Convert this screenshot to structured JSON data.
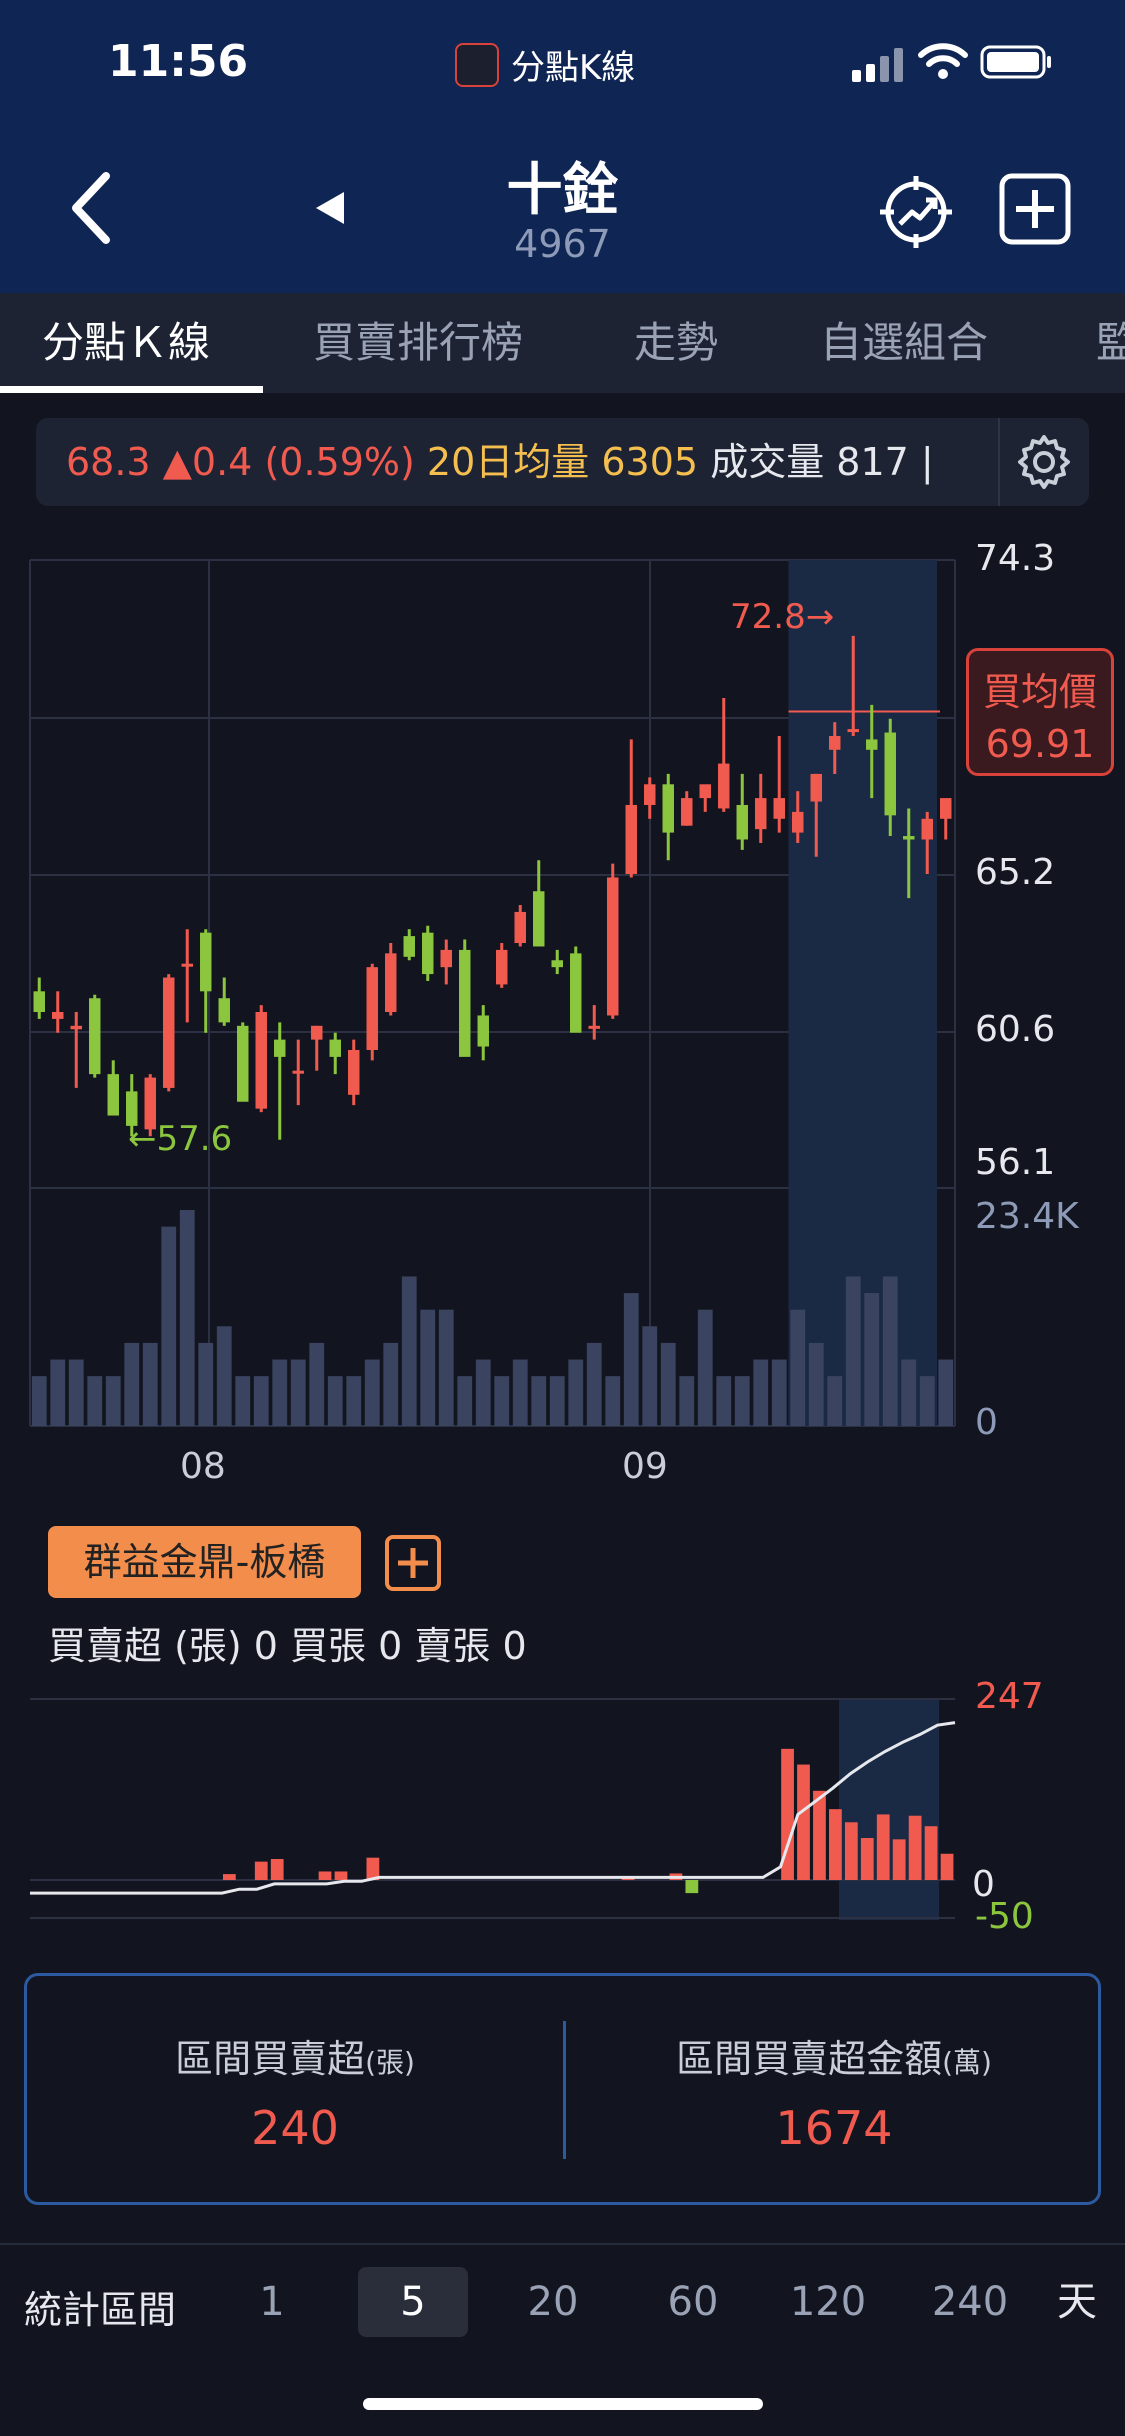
{
  "status_bar": {
    "time": "11:56",
    "app_name": "分點K線"
  },
  "header": {
    "stock_name": "十銓",
    "stock_code": "4967"
  },
  "tabs": [
    "分點Ｋ線",
    "買賣排行榜",
    "走勢",
    "自選組合",
    "監"
  ],
  "quote": {
    "price": "68.3",
    "change": "▲0.4",
    "change_pct": "(0.59%)",
    "avg_vol_label": "20日均量",
    "avg_vol": "6305",
    "volume_label": "成交量",
    "volume": "817",
    "separator": "|"
  },
  "avg_price_tag": {
    "label": "買均價",
    "value": "69.91"
  },
  "broker": {
    "name": "群益金鼎-板橋",
    "net_line": "買賣超 (張) 0 買張 0 賣張 0"
  },
  "summary": {
    "left_label": "區間買賣超",
    "left_unit": "(張)",
    "left_value": "240",
    "right_label": "區間買賣超金額",
    "right_unit": "(萬)",
    "right_value": "1674"
  },
  "period": {
    "label": "統計區間",
    "options": [
      "1",
      "5",
      "20",
      "60",
      "120",
      "240"
    ],
    "selected": "5",
    "unit": "天"
  },
  "colors": {
    "up": "#f15b4f",
    "down": "#8cc63f",
    "volume": "#3a4460",
    "highlight": "#1a2a44"
  },
  "chart_data": [
    {
      "type": "candlestick",
      "price_axis_ticks": [
        "74.3",
        "65.2",
        "60.6",
        "56.1"
      ],
      "volume_axis_ticks": [
        "23.4K",
        "0"
      ],
      "x_tick_labels": [
        "08",
        "09"
      ],
      "annotations": {
        "high": "72.8→",
        "low": "←57.6"
      },
      "ylim": [
        56.1,
        74.3
      ],
      "ohlc": [
        [
          61.8,
          62.2,
          61.0,
          61.2
        ],
        [
          61.0,
          61.8,
          60.6,
          61.2
        ],
        [
          60.7,
          61.2,
          59.0,
          60.8
        ],
        [
          61.6,
          61.7,
          59.3,
          59.4
        ],
        [
          59.4,
          59.8,
          58.6,
          58.2
        ],
        [
          58.9,
          59.4,
          57.6,
          57.9
        ],
        [
          57.8,
          59.4,
          57.6,
          59.3
        ],
        [
          59.0,
          62.3,
          58.9,
          62.2
        ],
        [
          62.6,
          63.6,
          60.9,
          62.6
        ],
        [
          63.5,
          63.6,
          60.6,
          61.8
        ],
        [
          61.6,
          62.2,
          60.8,
          60.9
        ],
        [
          60.8,
          60.9,
          59.6,
          58.6
        ],
        [
          58.4,
          61.4,
          58.3,
          61.2
        ],
        [
          60.4,
          60.9,
          57.5,
          59.9
        ],
        [
          59.5,
          60.4,
          58.5,
          59.5
        ],
        [
          60.4,
          60.8,
          59.5,
          60.8
        ],
        [
          60.4,
          60.6,
          59.4,
          59.9
        ],
        [
          58.8,
          60.4,
          58.5,
          60.1
        ],
        [
          60.1,
          62.6,
          59.8,
          62.5
        ],
        [
          61.2,
          63.2,
          61.1,
          62.9
        ],
        [
          63.4,
          63.6,
          62.7,
          62.8
        ],
        [
          63.5,
          63.7,
          62.1,
          62.3
        ],
        [
          62.5,
          63.3,
          62.0,
          63.0
        ],
        [
          63.0,
          63.3,
          61.2,
          59.9
        ],
        [
          61.1,
          61.4,
          59.8,
          60.2
        ],
        [
          62.0,
          63.2,
          61.9,
          63.0
        ],
        [
          63.2,
          64.3,
          63.1,
          64.1
        ],
        [
          64.7,
          65.6,
          63.1,
          63.1
        ],
        [
          62.7,
          63.0,
          62.3,
          62.5
        ],
        [
          62.9,
          63.1,
          60.9,
          60.6
        ],
        [
          60.8,
          61.4,
          60.4,
          60.8
        ],
        [
          61.1,
          65.5,
          61.0,
          65.1
        ],
        [
          65.2,
          69.1,
          65.1,
          67.2
        ],
        [
          67.2,
          68.0,
          66.8,
          67.8
        ],
        [
          67.8,
          68.1,
          65.6,
          66.4
        ],
        [
          66.6,
          67.6,
          66.6,
          67.4
        ],
        [
          67.4,
          67.6,
          67.0,
          67.8
        ],
        [
          67.1,
          70.3,
          67.0,
          68.4
        ],
        [
          67.2,
          68.1,
          65.9,
          66.2
        ],
        [
          66.5,
          68.1,
          66.1,
          67.4
        ],
        [
          66.8,
          69.2,
          66.4,
          67.4
        ],
        [
          66.4,
          67.6,
          66.1,
          67.0
        ],
        [
          67.3,
          68.1,
          65.7,
          68.1
        ],
        [
          68.8,
          69.6,
          68.1,
          69.2
        ],
        [
          69.4,
          72.1,
          69.2,
          69.4
        ],
        [
          69.1,
          70.1,
          67.4,
          68.8
        ],
        [
          69.3,
          69.7,
          66.3,
          66.9
        ],
        [
          66.3,
          67.1,
          64.5,
          66.2
        ],
        [
          66.2,
          67.0,
          65.2,
          66.8
        ],
        [
          66.8,
          67.2,
          66.2,
          67.4
        ]
      ],
      "highlight_start_index": 41,
      "volume": [
        3,
        4,
        4,
        3,
        3,
        5,
        5,
        12,
        13,
        5,
        6,
        3,
        3,
        4,
        4,
        5,
        3,
        3,
        4,
        5,
        9,
        7,
        7,
        3,
        4,
        3,
        4,
        3,
        3,
        4,
        5,
        3,
        8,
        6,
        5,
        3,
        7,
        3,
        3,
        4,
        4,
        7,
        5,
        3,
        9,
        8,
        9,
        4,
        3,
        4
      ],
      "avg_price_line": 69.91
    },
    {
      "type": "bar",
      "name": "broker_net",
      "axis_ticks": [
        "247",
        "0",
        "-50"
      ],
      "ylim": [
        -50,
        247
      ],
      "values": [
        0,
        0,
        0,
        0,
        0,
        0,
        0,
        0,
        0,
        0,
        0,
        0,
        9,
        0,
        28,
        32,
        0,
        0,
        13,
        13,
        0,
        34,
        0,
        0,
        0,
        0,
        0,
        0,
        0,
        0,
        0,
        0,
        0,
        0,
        0,
        0,
        0,
        6,
        0,
        0,
        10,
        -20,
        0,
        0,
        0,
        0,
        0,
        200,
        176,
        136,
        108,
        88,
        64,
        100,
        62,
        98,
        82,
        40
      ],
      "cumulative": [
        -20,
        -20,
        -20,
        -20,
        -20,
        -20,
        -20,
        -20,
        -20,
        -20,
        -20,
        -20,
        -14,
        -14,
        -6,
        -6,
        -6,
        -6,
        -2,
        -2,
        4,
        4,
        4,
        4,
        4,
        4,
        4,
        4,
        4,
        4,
        4,
        4,
        4,
        4,
        4,
        4,
        4,
        4,
        4,
        4,
        4,
        4,
        4,
        20,
        100,
        120,
        140,
        162,
        180,
        196,
        210,
        222,
        236,
        240
      ]
    }
  ]
}
